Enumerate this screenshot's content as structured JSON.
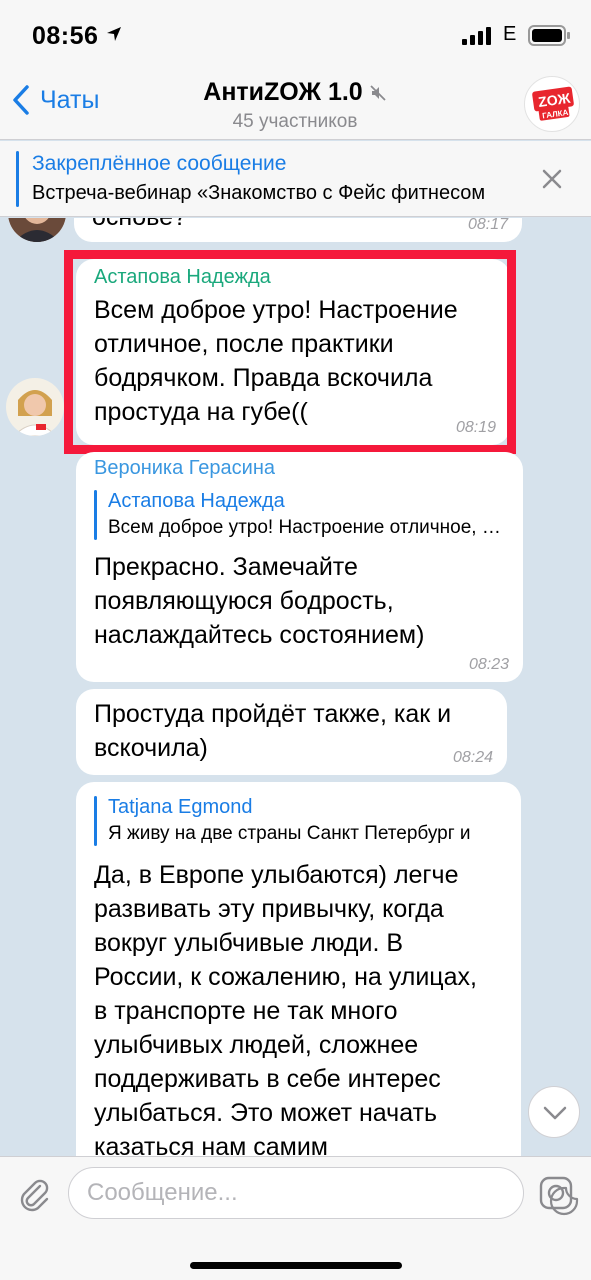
{
  "status": {
    "time": "08:56",
    "network": "E"
  },
  "header": {
    "back_label": "Чаты",
    "title": "АнтиZОЖ 1.0",
    "subtitle": "45 участников",
    "group_logo_text": "ZOЖ ГАЛКА"
  },
  "pinned": {
    "title": "Закреплённое сообщение",
    "text": "Встреча-вебинар «Знакомство с Фейс фитнесом"
  },
  "messages": [
    {
      "text": "основе?",
      "time": "08:17"
    },
    {
      "sender": "Астапова Надежда",
      "text": "Всем доброе утро! Настроение отличное, после практики бодрячком. Правда вскочила простуда на губе((",
      "time": "08:19"
    },
    {
      "sender": "Вероника Герасина",
      "reply_name": "Астапова Надежда",
      "reply_text": "Всем доброе утро! Настроение отличное, после практики",
      "text": "Прекрасно. Замечайте появляющуюся бодрость, наслаждайтесь состоянием)",
      "time": "08:23"
    },
    {
      "text": "Простуда пройдёт также, как и вскочила)",
      "time": "08:24"
    },
    {
      "reply_name": "Tatjana Egmond",
      "reply_text": "Я живу на две страны Санкт Петербург и",
      "text": "Да, в Европе улыбаются) легче развивать эту привычку, когда вокруг улыбчивые люди. В России, к сожалению, на улицах, в транспорте не так много улыбчивых людей, сложнее поддерживать в себе интерес улыбаться. Это может начать казаться нам самим"
    }
  ],
  "input": {
    "placeholder": "Сообщение..."
  },
  "colors": {
    "accent": "#1a7de5",
    "highlight": "#f5193b",
    "sender1": "#1aa87c",
    "sender2": "#3a97e0"
  }
}
